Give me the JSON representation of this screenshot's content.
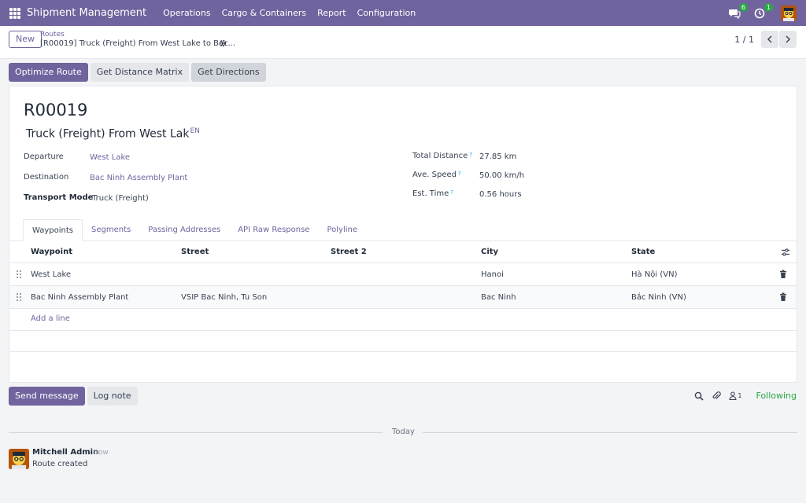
{
  "app": {
    "brand": "Shipment Management",
    "menu": [
      "Operations",
      "Cargo & Containers",
      "Report",
      "Configuration"
    ],
    "badges": {
      "messages": "6",
      "activities": "1"
    }
  },
  "control": {
    "new_label": "New",
    "breadcrumb": "Routes",
    "record_name": "[R00019] Truck (Freight) From West Lake to Bac...",
    "pager": "1 / 1"
  },
  "actions": [
    "Optimize Route",
    "Get Distance Matrix",
    "Get Directions"
  ],
  "record": {
    "code": "R00019",
    "name": "Truck (Freight) From West Lak",
    "lang": "EN",
    "fields_left": [
      {
        "label": "Departure",
        "value": "West Lake"
      },
      {
        "label": "Destination",
        "value": "Bac Ninh Assembly Plant"
      },
      {
        "label": "Transport Mode",
        "value": "Truck (Freight)"
      }
    ],
    "fields_right": [
      {
        "label": "Total Distance",
        "value": "27.85 km"
      },
      {
        "label": "Ave. Speed",
        "value": "50.00 km/h"
      },
      {
        "label": "Est. Time",
        "value": "0.56 hours"
      }
    ],
    "help_mark": "?"
  },
  "tabs": [
    "Waypoints",
    "Segments",
    "Passing Addresses",
    "API Raw Response",
    "Polyline"
  ],
  "table": {
    "columns": [
      "Waypoint",
      "Street",
      "Street 2",
      "City",
      "State"
    ],
    "rows": [
      {
        "waypoint": "West Lake",
        "street": "",
        "street2": "",
        "city": "Hanoi",
        "state": "Hà Nội (VN)"
      },
      {
        "waypoint": "Bac Ninh Assembly Plant",
        "street": "VSIP Bac Ninh, Tu Son",
        "street2": "",
        "city": "Bac Ninh",
        "state": "Bắc Ninh (VN)"
      }
    ],
    "add_line": "Add a line"
  },
  "chatter": {
    "send_message": "Send message",
    "log_note": "Log note",
    "followers_count": "1",
    "following": "Following",
    "today": "Today",
    "message": {
      "author": "Mitchell Admin",
      "time": "- now",
      "body": "Route created"
    }
  }
}
